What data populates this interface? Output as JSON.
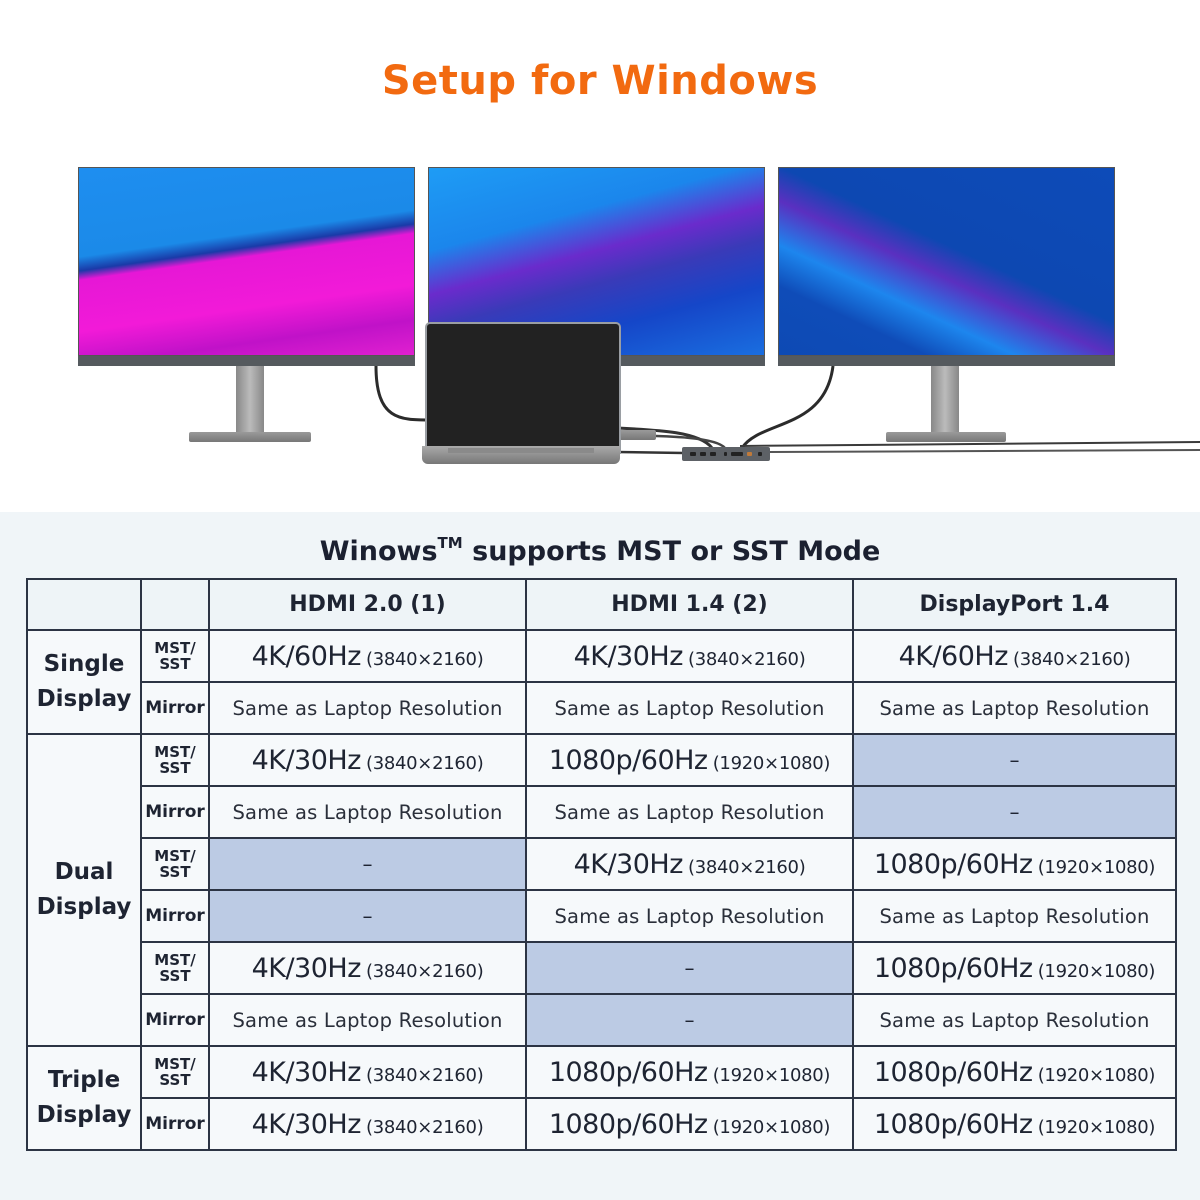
{
  "page": {
    "title": "Setup for Windows",
    "colors": {
      "title": "#f26a10",
      "text": "#1e2432",
      "na_cell": "#bccbe4",
      "border": "#2c3444",
      "section_bg": "#f0f5f8"
    }
  },
  "illustration": {
    "devices": [
      "monitor-left",
      "monitor-center",
      "monitor-right",
      "laptop",
      "docking-station"
    ]
  },
  "table": {
    "title_main": "Winows",
    "title_tm": "TM",
    "title_rest": " supports MST or SST Mode",
    "columns": [
      "HDMI 2.0 (1)",
      "HDMI 1.4 (2)",
      "DisplayPort 1.4"
    ],
    "not_available": "–",
    "groups": [
      {
        "line1": "Single",
        "line2": "Display",
        "rows": [
          {
            "mode1": "MST/",
            "mode2": "SST",
            "cells": [
              {
                "main": "4K/60Hz",
                "res": "(3840×2160)"
              },
              {
                "main": "4K/30Hz",
                "res": "(3840×2160)"
              },
              {
                "main": "4K/60Hz",
                "res": "(3840×2160)"
              }
            ]
          },
          {
            "mode1": "Mirror",
            "mode2": "",
            "cells": [
              {
                "text": "Same as Laptop Resolution"
              },
              {
                "text": "Same as Laptop Resolution"
              },
              {
                "text": "Same as Laptop Resolution"
              }
            ]
          }
        ]
      },
      {
        "line1": "Dual",
        "line2": "Display",
        "rows": [
          {
            "mode1": "MST/",
            "mode2": "SST",
            "cells": [
              {
                "main": "4K/30Hz",
                "res": "(3840×2160)"
              },
              {
                "main": "1080p/60Hz",
                "res": "(1920×1080)"
              },
              {
                "na": true
              }
            ]
          },
          {
            "mode1": "Mirror",
            "mode2": "",
            "cells": [
              {
                "text": "Same as Laptop Resolution"
              },
              {
                "text": "Same as Laptop Resolution"
              },
              {
                "na": true
              }
            ]
          },
          {
            "mode1": "MST/",
            "mode2": "SST",
            "cells": [
              {
                "na": true
              },
              {
                "main": "4K/30Hz",
                "res": "(3840×2160)"
              },
              {
                "main": "1080p/60Hz",
                "res": "(1920×1080)"
              }
            ]
          },
          {
            "mode1": "Mirror",
            "mode2": "",
            "cells": [
              {
                "na": true
              },
              {
                "text": "Same as Laptop Resolution"
              },
              {
                "text": "Same as Laptop Resolution"
              }
            ]
          },
          {
            "mode1": "MST/",
            "mode2": "SST",
            "cells": [
              {
                "main": "4K/30Hz",
                "res": "(3840×2160)"
              },
              {
                "na": true
              },
              {
                "main": "1080p/60Hz",
                "res": "(1920×1080)"
              }
            ]
          },
          {
            "mode1": "Mirror",
            "mode2": "",
            "cells": [
              {
                "text": "Same as Laptop Resolution"
              },
              {
                "na": true
              },
              {
                "text": "Same as Laptop Resolution"
              }
            ]
          }
        ]
      },
      {
        "line1": "Triple",
        "line2": "Display",
        "rows": [
          {
            "mode1": "MST/",
            "mode2": "SST",
            "cells": [
              {
                "main": "4K/30Hz",
                "res": "(3840×2160)"
              },
              {
                "main": "1080p/60Hz",
                "res": "(1920×1080)"
              },
              {
                "main": "1080p/60Hz",
                "res": "(1920×1080)"
              }
            ]
          },
          {
            "mode1": "Mirror",
            "mode2": "",
            "cells": [
              {
                "main": "4K/30Hz",
                "res": "(3840×2160)"
              },
              {
                "main": "1080p/60Hz",
                "res": "(1920×1080)"
              },
              {
                "main": "1080p/60Hz",
                "res": "(1920×1080)"
              }
            ]
          }
        ]
      }
    ]
  }
}
